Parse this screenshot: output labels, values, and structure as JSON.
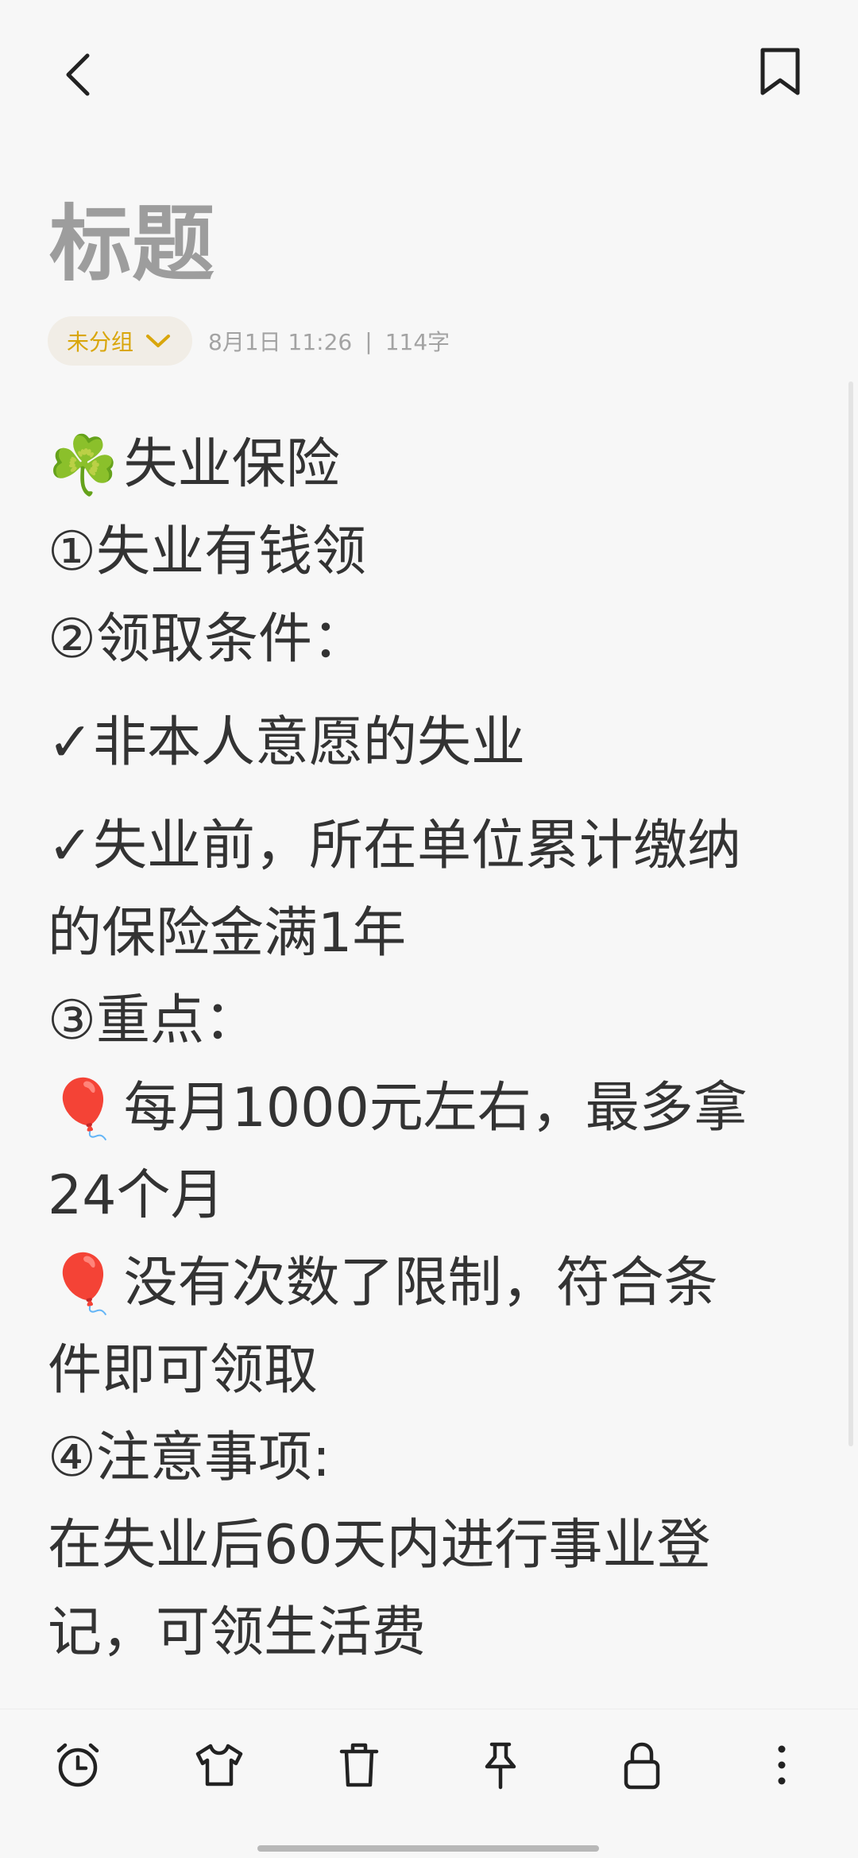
{
  "header": {
    "back_icon": "chevron-left-icon",
    "bookmark_icon": "bookmark-icon"
  },
  "note": {
    "title_placeholder": "标题",
    "group_label": "未分组",
    "date": "8月1日 11:26",
    "separator": "|",
    "word_count": "114字",
    "lines": [
      {
        "emoji": "☘️",
        "text": "失业保险"
      },
      {
        "text": "①失业有钱领"
      },
      {
        "text": "②领取条件："
      },
      {
        "text": "✓非本人意愿的失业"
      },
      {
        "text": "✓失业前，所在单位累计缴纳"
      },
      {
        "text": "的保险金满1年"
      },
      {
        "text": "③重点："
      },
      {
        "emoji": "🎈",
        "text": "每月1000元左右，最多拿"
      },
      {
        "text": "24个月"
      },
      {
        "emoji": "🎈",
        "text": "没有次数了限制，符合条"
      },
      {
        "text": "件即可领取"
      },
      {
        "text": "④注意事项:"
      },
      {
        "text": "在失业后60天内进行事业登"
      },
      {
        "text": "记，可领生活费"
      }
    ]
  },
  "toolbar": {
    "icons": [
      "alarm-clock-icon",
      "shirt-icon",
      "trash-icon",
      "pin-icon",
      "lock-icon",
      "more-vertical-icon"
    ]
  }
}
